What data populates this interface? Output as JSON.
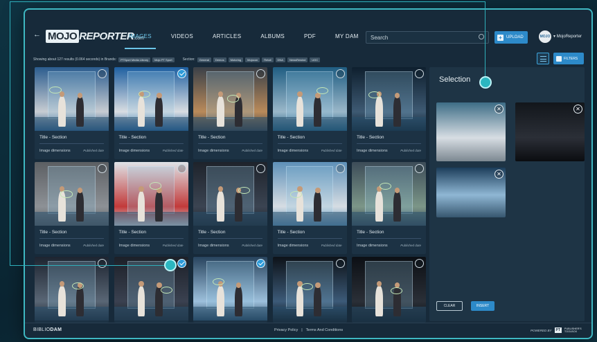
{
  "brand": {
    "logo_part1": "MOJO",
    "logo_part2": "REPORTER",
    "logo_suffix": ".com",
    "footer_logo_part1": "BIBLIO",
    "footer_logo_part2": "DAM"
  },
  "nav": {
    "back_label": "←",
    "tabs": [
      "IMAGES",
      "VIDEOS",
      "ARTICLES",
      "ALBUMS",
      "PDF",
      "MY DAM"
    ],
    "active_tab": "IMAGES"
  },
  "search": {
    "value": "Search"
  },
  "upload": {
    "label": "UPLOAD",
    "icon": "plus-icon"
  },
  "user": {
    "name": "MojoReporter",
    "avatar_text": "MOJO"
  },
  "results": {
    "summary": "Showing about 127 results (0.064 seconds) in Brands:",
    "brands": [
      "PTSport Media Library",
      "Mojo PT Sport"
    ],
    "section_label": "Section:",
    "sections": [
      "General",
      "Demos",
      "Motoring",
      "Mojocon",
      "Retail",
      "DNA",
      "NewsRewind",
      "UGC"
    ]
  },
  "filters": {
    "label": "FILTERS"
  },
  "cards": [
    {
      "title": "Title - Section",
      "dimensions": "Image dimensions",
      "date": "Published date",
      "selected": false
    },
    {
      "title": "Title - Section",
      "dimensions": "Image dimensions",
      "date": "Published date",
      "selected": true
    },
    {
      "title": "Title - Section",
      "dimensions": "Image dimensions",
      "date": "Published date",
      "selected": false
    },
    {
      "title": "Title - Section",
      "dimensions": "Image dimensions",
      "date": "Published date",
      "selected": false
    },
    {
      "title": "Title - Section",
      "dimensions": "Image dimensions",
      "date": "Published date",
      "selected": false
    },
    {
      "title": "Title - Section",
      "dimensions": "Image dimensions",
      "date": "Published date",
      "selected": false
    },
    {
      "title": "Title - Section",
      "dimensions": "Image dimensions",
      "date": "Published date",
      "selected": false
    },
    {
      "title": "Title - Section",
      "dimensions": "Image dimensions",
      "date": "Published date",
      "selected": false
    },
    {
      "title": "Title - Section",
      "dimensions": "Image dimensions",
      "date": "Published date",
      "selected": false
    },
    {
      "title": "Title - Section",
      "dimensions": "Image dimensions",
      "date": "Published date",
      "selected": false
    },
    {
      "title": "Title - Section",
      "dimensions": "Image dimensions",
      "date": "Published date",
      "selected": false
    },
    {
      "title": "Title - Section",
      "dimensions": "Image dimensions",
      "date": "Published date",
      "selected": true
    },
    {
      "title": "Title - Section",
      "dimensions": "Image dimensions",
      "date": "Published date",
      "selected": true
    },
    {
      "title": "Title - Section",
      "dimensions": "Image dimensions",
      "date": "Published date",
      "selected": false
    },
    {
      "title": "Title - Section",
      "dimensions": "Image dimensions",
      "date": "Published date",
      "selected": false
    }
  ],
  "selection": {
    "title": "Selection",
    "remove_icon": "close-icon",
    "clear_label": "CLEAR",
    "insert_label": "INSERT"
  },
  "footer": {
    "privacy": "Privacy Policy",
    "separator": "|",
    "terms": "Terms And Conditions",
    "powered_by": "POWERED BY",
    "pt_mark": "PT",
    "toolbox_line1": "PUBLISHER'S",
    "toolbox_line2": "TOOLBOX"
  },
  "colors": {
    "accent": "#2d8ac9",
    "active_tab": "#6cc6e9",
    "callout": "#2bb6c0",
    "panel": "#1e3445",
    "frame": "#172a3a"
  }
}
